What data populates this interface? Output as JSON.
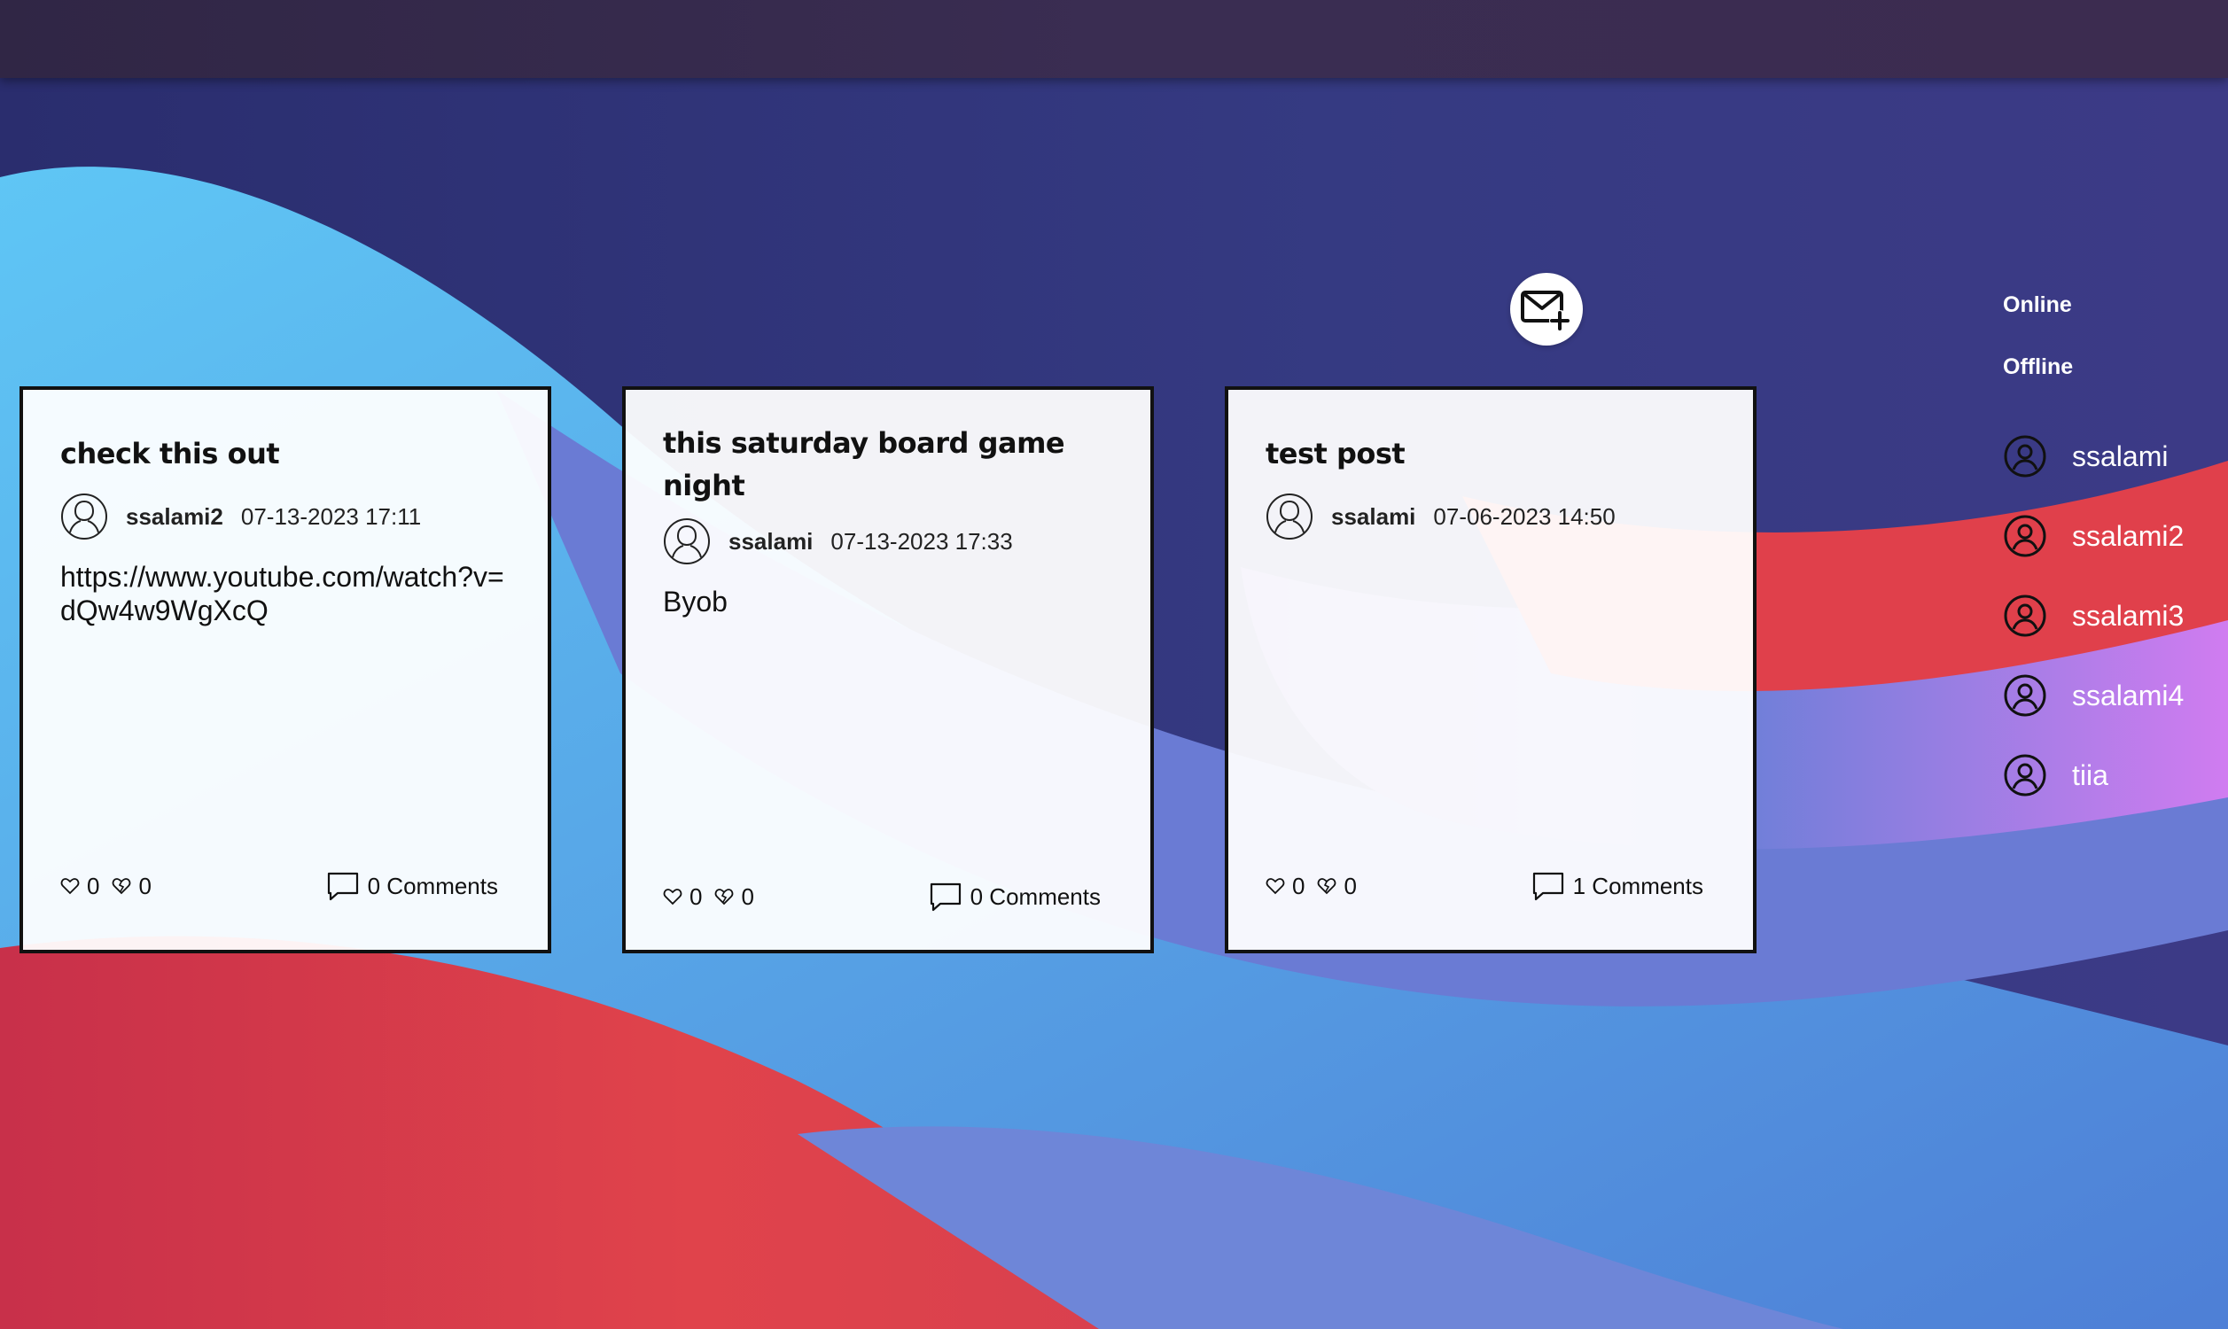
{
  "colors": {
    "topbar": "#332848",
    "card_border": "#111111",
    "panel_text": "#ffffff"
  },
  "compose": {
    "icon": "mail-plus-icon"
  },
  "posts": [
    {
      "title": "check this out",
      "author": "ssalami2",
      "date": "07-13-2023 17:11",
      "body": "https://www.youtube.com/watch?v=dQw4w9WgXcQ",
      "likes": "0",
      "dislikes": "0",
      "comments_label": "0 Comments"
    },
    {
      "title": "this saturday board game night",
      "author": "ssalami",
      "date": "07-13-2023 17:33",
      "body": "Byob",
      "likes": "0",
      "dislikes": "0",
      "comments_label": "0 Comments"
    },
    {
      "title": "test post",
      "author": "ssalami",
      "date": "07-06-2023 14:50",
      "body": "",
      "likes": "0",
      "dislikes": "0",
      "comments_label": "1 Comments"
    }
  ],
  "users_panel": {
    "online_label": "Online",
    "offline_label": "Offline",
    "offline_users": [
      "ssalami",
      "ssalami2",
      "ssalami3",
      "ssalami4",
      "tiia"
    ]
  }
}
